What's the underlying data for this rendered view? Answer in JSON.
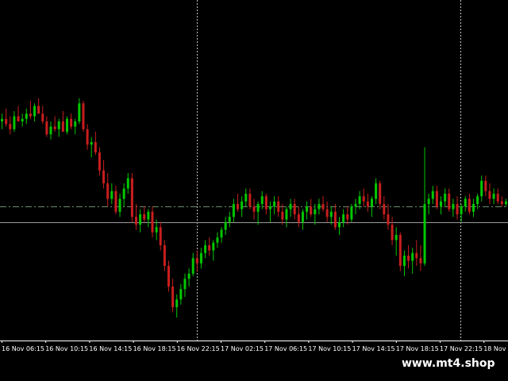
{
  "chart_data": {
    "type": "candlestick",
    "title": "",
    "xlabel": "",
    "ylabel": "",
    "grid": false,
    "x_tick_labels": [
      "16 Nov 06:15",
      "16 Nov 10:15",
      "16 Nov 14:15",
      "16 Nov 18:15",
      "16 Nov 22:15",
      "17 Nov 02:15",
      "17 Nov 06:15",
      "17 Nov 10:15",
      "17 Nov 14:15",
      "17 Nov 18:15",
      "17 Nov 22:15",
      "18 Nov 0"
    ],
    "ylim": [
      0,
      100
    ],
    "candles": [
      [
        76,
        79,
        73,
        77
      ],
      [
        77,
        81,
        74,
        75
      ],
      [
        75,
        78,
        71,
        73
      ],
      [
        73,
        80,
        72,
        78
      ],
      [
        78,
        82,
        76,
        76
      ],
      [
        76,
        79,
        74,
        77
      ],
      [
        77,
        81,
        75,
        79
      ],
      [
        79,
        84,
        77,
        78
      ],
      [
        78,
        83,
        76,
        82
      ],
      [
        82,
        85,
        80,
        79
      ],
      [
        79,
        82,
        75,
        76
      ],
      [
        76,
        78,
        70,
        71
      ],
      [
        71,
        76,
        69,
        74
      ],
      [
        74,
        78,
        72,
        73
      ],
      [
        73,
        77,
        70,
        76
      ],
      [
        76,
        80,
        73,
        72
      ],
      [
        72,
        78,
        71,
        77
      ],
      [
        77,
        79,
        73,
        74
      ],
      [
        74,
        77,
        71,
        76
      ],
      [
        76,
        85,
        75,
        83
      ],
      [
        83,
        84,
        72,
        73
      ],
      [
        73,
        75,
        65,
        67
      ],
      [
        67,
        70,
        62,
        68
      ],
      [
        68,
        72,
        63,
        64
      ],
      [
        64,
        66,
        55,
        57
      ],
      [
        57,
        61,
        50,
        52
      ],
      [
        52,
        56,
        43,
        46
      ],
      [
        46,
        52,
        44,
        49
      ],
      [
        49,
        51,
        40,
        41
      ],
      [
        41,
        48,
        39,
        46
      ],
      [
        46,
        52,
        43,
        50
      ],
      [
        50,
        56,
        48,
        54
      ],
      [
        54,
        56,
        37,
        39
      ],
      [
        39,
        44,
        34,
        36
      ],
      [
        36,
        42,
        33,
        40
      ],
      [
        40,
        43,
        37,
        38
      ],
      [
        38,
        42,
        35,
        41
      ],
      [
        41,
        43,
        31,
        33
      ],
      [
        33,
        38,
        30,
        35
      ],
      [
        35,
        37,
        26,
        28
      ],
      [
        28,
        30,
        18,
        20
      ],
      [
        20,
        22,
        10,
        12
      ],
      [
        12,
        15,
        2,
        4
      ],
      [
        4,
        9,
        0,
        7
      ],
      [
        7,
        13,
        5,
        11
      ],
      [
        11,
        17,
        8,
        15
      ],
      [
        15,
        19,
        12,
        17
      ],
      [
        17,
        25,
        16,
        23
      ],
      [
        23,
        26,
        18,
        21
      ],
      [
        21,
        27,
        19,
        25
      ],
      [
        25,
        30,
        23,
        28
      ],
      [
        28,
        31,
        24,
        26
      ],
      [
        26,
        30,
        22,
        29
      ],
      [
        29,
        33,
        27,
        31
      ],
      [
        31,
        35,
        29,
        34
      ],
      [
        34,
        39,
        32,
        37
      ],
      [
        37,
        41,
        35,
        39
      ],
      [
        39,
        46,
        37,
        44
      ],
      [
        44,
        48,
        41,
        42
      ],
      [
        42,
        47,
        39,
        45
      ],
      [
        45,
        50,
        43,
        48
      ],
      [
        48,
        50,
        42,
        43
      ],
      [
        43,
        46,
        38,
        41
      ],
      [
        41,
        45,
        36,
        44
      ],
      [
        44,
        49,
        42,
        47
      ],
      [
        47,
        48,
        40,
        42
      ],
      [
        42,
        45,
        37,
        43
      ],
      [
        43,
        47,
        40,
        45
      ],
      [
        45,
        47,
        39,
        41
      ],
      [
        41,
        44,
        36,
        38
      ],
      [
        38,
        43,
        35,
        42
      ],
      [
        42,
        46,
        39,
        44
      ],
      [
        44,
        46,
        38,
        40
      ],
      [
        40,
        43,
        35,
        37
      ],
      [
        37,
        42,
        34,
        41
      ],
      [
        41,
        45,
        38,
        43
      ],
      [
        43,
        46,
        39,
        40
      ],
      [
        40,
        44,
        36,
        42
      ],
      [
        42,
        46,
        40,
        44
      ],
      [
        44,
        47,
        41,
        42
      ],
      [
        42,
        45,
        37,
        39
      ],
      [
        39,
        43,
        36,
        41
      ],
      [
        41,
        44,
        34,
        35
      ],
      [
        35,
        39,
        32,
        37
      ],
      [
        37,
        42,
        35,
        40
      ],
      [
        40,
        43,
        36,
        38
      ],
      [
        38,
        44,
        37,
        43
      ],
      [
        43,
        46,
        40,
        44
      ],
      [
        44,
        49,
        42,
        47
      ],
      [
        47,
        50,
        43,
        45
      ],
      [
        45,
        48,
        41,
        43
      ],
      [
        43,
        47,
        39,
        46
      ],
      [
        46,
        54,
        44,
        52
      ],
      [
        52,
        53,
        42,
        44
      ],
      [
        44,
        47,
        38,
        40
      ],
      [
        40,
        44,
        34,
        36
      ],
      [
        36,
        39,
        28,
        30
      ],
      [
        30,
        35,
        24,
        32
      ],
      [
        32,
        33,
        18,
        20
      ],
      [
        20,
        26,
        16,
        24
      ],
      [
        24,
        28,
        19,
        22
      ],
      [
        22,
        27,
        17,
        25
      ],
      [
        25,
        30,
        20,
        23
      ],
      [
        23,
        28,
        18,
        21
      ],
      [
        21,
        66,
        20,
        44
      ],
      [
        44,
        48,
        40,
        46
      ],
      [
        46,
        51,
        44,
        49
      ],
      [
        49,
        51,
        42,
        43
      ],
      [
        43,
        47,
        40,
        45
      ],
      [
        45,
        50,
        43,
        48
      ],
      [
        48,
        50,
        41,
        42
      ],
      [
        42,
        46,
        39,
        44
      ],
      [
        44,
        47,
        38,
        40
      ],
      [
        40,
        44,
        37,
        43
      ],
      [
        43,
        47,
        41,
        46
      ],
      [
        46,
        48,
        40,
        41
      ],
      [
        41,
        46,
        39,
        44
      ],
      [
        44,
        48,
        42,
        47
      ],
      [
        47,
        55,
        45,
        53
      ],
      [
        53,
        55,
        47,
        49
      ],
      [
        49,
        52,
        44,
        46
      ],
      [
        46,
        50,
        44,
        48
      ],
      [
        48,
        50,
        44,
        45
      ],
      [
        45,
        47,
        43,
        44
      ],
      [
        44,
        46,
        43,
        45
      ]
    ]
  },
  "watermark": "www.mt4.shop",
  "colors": {
    "background": "#000000",
    "bull": "#00c800",
    "bear": "#c81e1e",
    "grid_separator": "#c0c0c0",
    "level_line": "#9a9a9a",
    "bid_line": "#6a8f6a",
    "text": "#ffffff"
  }
}
